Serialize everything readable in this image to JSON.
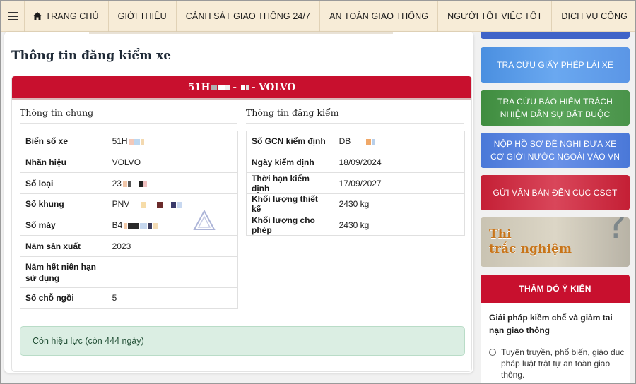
{
  "nav": {
    "items": [
      {
        "label": "TRANG CHỦ"
      },
      {
        "label": "GIỚI THIỆU"
      },
      {
        "label": "CẢNH SÁT GIAO THÔNG 24/7"
      },
      {
        "label": "AN TOÀN GIAO THÔNG"
      },
      {
        "label": "NGƯỜI TỐT VIỆC TỐT"
      },
      {
        "label": "DỊCH VỤ CÔNG"
      }
    ]
  },
  "page": {
    "title": "Thông tin đăng kiểm xe",
    "plate_prefix": "51H",
    "plate_dash": "-",
    "plate_suffix": "- VOLVO"
  },
  "general": {
    "title": "Thông tin chung",
    "rows": [
      {
        "label": "Biển số xe",
        "value": "51H"
      },
      {
        "label": "Nhãn hiệu",
        "value": "VOLVO"
      },
      {
        "label": "Số loại",
        "value": "23"
      },
      {
        "label": "Số khung",
        "value": "PNV"
      },
      {
        "label": "Số máy",
        "value": "B4"
      },
      {
        "label": "Năm sản xuất",
        "value": "2023"
      },
      {
        "label": "Năm hết niên hạn sử dụng",
        "value": ""
      },
      {
        "label": "Số chỗ ngồi",
        "value": "5"
      }
    ]
  },
  "inspection": {
    "title": "Thông tin đăng kiểm",
    "rows": [
      {
        "label": "Số GCN kiểm định",
        "value": "DB"
      },
      {
        "label": "Ngày kiểm định",
        "value": "18/09/2024"
      },
      {
        "label": "Thời hạn kiểm định",
        "value": "17/09/2027"
      },
      {
        "label": "Khối lượng thiết kế",
        "value": "2430 kg"
      },
      {
        "label": "Khối lượng cho phép",
        "value": "2430 kg"
      }
    ]
  },
  "status": {
    "text": "Còn hiệu lực (còn 444 ngày)"
  },
  "sidebar": {
    "banners": [
      {
        "label": "TRA CỨU GIẤY PHÉP LÁI XE"
      },
      {
        "label": "TRA CỨU BẢO HIỂM TRÁCH NHIỆM DÂN SỰ BẮT BUỘC"
      },
      {
        "label": "NỘP HỒ SƠ ĐỀ NGHỊ ĐƯA XE CƠ GIỚI NƯỚC NGOÀI VÀO VN"
      },
      {
        "label": "GỬI VĂN BẢN ĐẾN CỤC CSGT"
      }
    ],
    "quiz": {
      "line1": "Thi",
      "line2": "trắc nghiệm"
    },
    "poll": {
      "title": "THĂM DÒ Ý KIẾN",
      "question": "Giải pháp kiềm chế và giảm tai nạn giao thông",
      "option": "Tuyên truyền, phổ biến, giáo dục pháp luật trật tự an toàn giao thông."
    }
  },
  "colors": {
    "brand_red": "#c8102e",
    "nav_bg": "#f7ecd7",
    "status_bg": "#dbeee3"
  }
}
